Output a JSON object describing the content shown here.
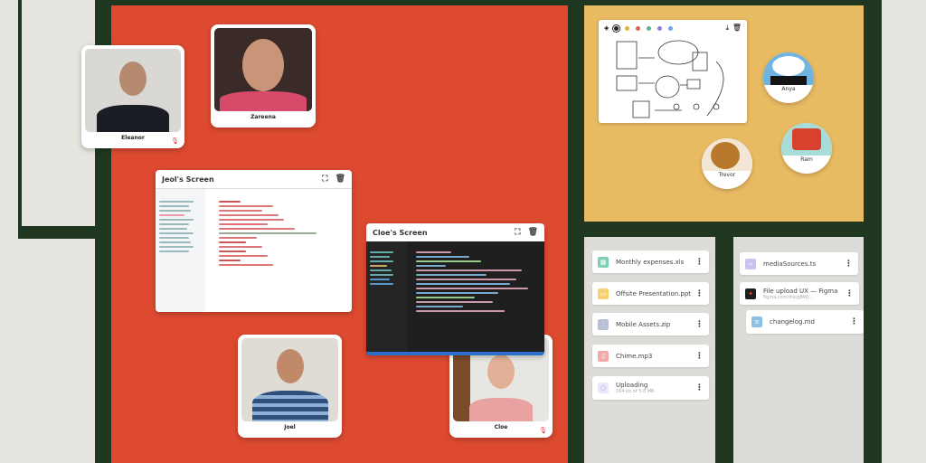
{
  "participants": [
    {
      "name": "Eleanor"
    },
    {
      "name": "Zareena"
    },
    {
      "name": "Joel"
    },
    {
      "name": "Cloe"
    }
  ],
  "screens": [
    {
      "title": "Jeol's Screen"
    },
    {
      "title": "Cloe's Screen"
    }
  ],
  "whiteboard": {
    "colors": [
      "#222222",
      "#e3b23c",
      "#e0605a",
      "#5fb39a",
      "#8a7fe0",
      "#6ea4e8"
    ]
  },
  "avatars": [
    {
      "name": "Anya"
    },
    {
      "name": "Ram"
    },
    {
      "name": "Trevor"
    }
  ],
  "files_left": [
    {
      "name": "Monthly expenses.xls",
      "color": "#7fcfb8"
    },
    {
      "name": "Offsite Presentation.ppt",
      "color": "#f6cf72"
    },
    {
      "name": "Mobile Assets.zip",
      "color": "#b9bfd6"
    },
    {
      "name": "Chime.mp3",
      "color": "#f3a9a9"
    }
  ],
  "uploading": {
    "label": "Uploading",
    "progress": "164 kb of 5.8 MB"
  },
  "files_right": [
    {
      "name": "mediaSources.ts",
      "color": "#c8c2ef"
    },
    {
      "name": "File upload UX — Figma",
      "sub": "figma.com/file/gBWj...",
      "color": "#1e1e1e"
    },
    {
      "name": "changelog.md",
      "color": "#8ec0e6"
    }
  ]
}
